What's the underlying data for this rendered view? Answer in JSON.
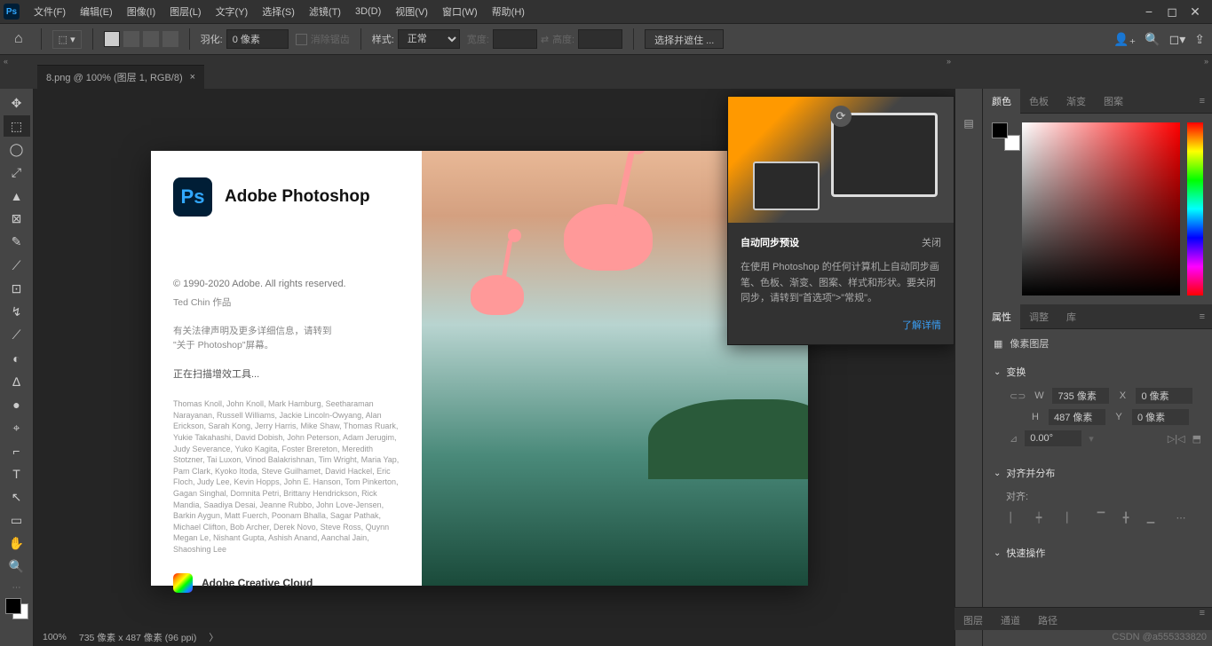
{
  "app_icon": "Ps",
  "menubar": [
    "文件(F)",
    "编辑(E)",
    "图像(I)",
    "图层(L)",
    "文字(Y)",
    "选择(S)",
    "滤镜(T)",
    "3D(D)",
    "视图(V)",
    "窗口(W)",
    "帮助(H)"
  ],
  "optbar": {
    "feather_label": "羽化:",
    "feather_value": "0 像素",
    "antialias": "消除锯齿",
    "style_label": "样式:",
    "style_value": "正常",
    "width_label": "宽度:",
    "height_label": "高度:",
    "mask_btn": "选择并遮住 ..."
  },
  "doctab": {
    "title": "8.png @ 100% (图层 1, RGB/8)",
    "close": "×"
  },
  "tools": [
    "✥",
    "⬚",
    "◯",
    "⤢",
    "▲",
    "⊠",
    "✎",
    "⟋",
    "⊡",
    "↯",
    "⟋",
    "◐",
    "∆",
    "●",
    "⌖",
    "⌐",
    "T",
    "↖",
    "▭",
    "✋",
    "🔍"
  ],
  "splash": {
    "title": "Adobe Photoshop",
    "copyright": "© 1990-2020 Adobe. All rights reserved.",
    "author": "Ted Chin 作品",
    "legal": "有关法律声明及更多详细信息，请转到\n\"关于 Photoshop\"屏幕。",
    "scanning": "正在扫描增效工具...",
    "credits": "Thomas Knoll, John Knoll, Mark Hamburg, Seetharaman Narayanan, Russell Williams, Jackie Lincoln-Owyang, Alan Erickson, Sarah Kong, Jerry Harris, Mike Shaw, Thomas Ruark, Yukie Takahashi, David Dobish, John Peterson, Adam Jerugim, Judy Severance, Yuko Kagita, Foster Brereton, Meredith Stotzner, Tai Luxon, Vinod Balakrishnan, Tim Wright, Maria Yap, Pam Clark, Kyoko Itoda, Steve Guilhamet, David Hackel, Eric Floch, Judy Lee, Kevin Hopps, John E. Hanson, Tom Pinkerton, Gagan Singhal, Domnita Petri, Brittany Hendrickson, Rick Mandia, Saadiya Desai, Jeanne Rubbo, John Love-Jensen, Barkin Aygun, Matt Fuerch, Poonam Bhalla, Sagar Pathak, Michael Clifton, Bob Archer, Derek Novo, Steve Ross, Quynn Megan Le, Nishant Gupta, Ashish Anand, Aanchal Jain, Shaoshing Lee",
    "cc_label": "Adobe Creative Cloud"
  },
  "notif": {
    "title": "自动同步预设",
    "close": "关闭",
    "body": "在使用 Photoshop 的任何计算机上自动同步画笔、色板、渐变、图案、样式和形状。要关闭同步，请转到\"首选项\">\"常规\"。",
    "link": "了解详情"
  },
  "panels": {
    "color_tabs": [
      "颜色",
      "色板",
      "渐变",
      "图案"
    ],
    "prop_tabs": [
      "属性",
      "调整",
      "库"
    ],
    "pixel_layer": "像素图层",
    "transform": "变换",
    "w_label": "W",
    "w_val": "735 像素",
    "h_label": "H",
    "h_val": "487 像素",
    "x_label": "X",
    "x_val": "0 像素",
    "y_label": "Y",
    "y_val": "0 像素",
    "angle": "0.00°",
    "align_section": "对齐并分布",
    "align_label": "对齐:",
    "quick_section": "快速操作",
    "bottom_tabs": [
      "图层",
      "通道",
      "路径"
    ]
  },
  "status": {
    "zoom": "100%",
    "dims": "735 像素 x 487 像素 (96 ppi)"
  },
  "watermark": "CSDN @a555333820"
}
